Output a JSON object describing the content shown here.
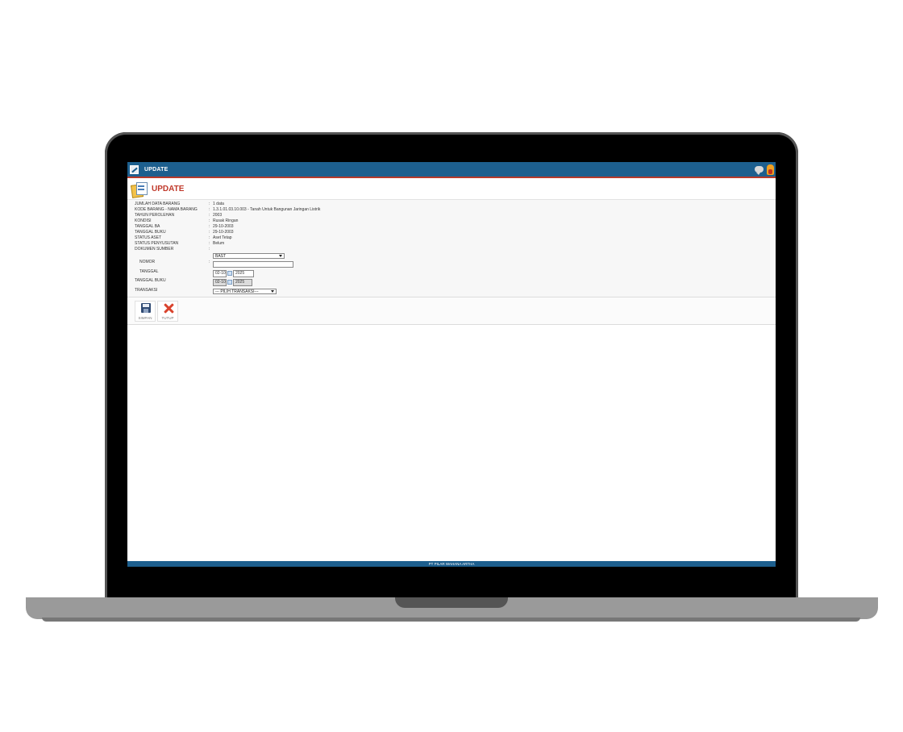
{
  "window": {
    "title": "UPDATE"
  },
  "page": {
    "title": "UPDATE"
  },
  "form": {
    "fields": [
      {
        "label": "JUMLAH DATA BARANG",
        "value": "1 data"
      },
      {
        "label": "KODE BARANG - NAMA BARANG",
        "value": "1.3.1.01.03.10.003 - Tanah Untuk Bangunan Jaringan Listrik"
      },
      {
        "label": "TAHUN PEROLEHAN",
        "value": "2003"
      },
      {
        "label": "KONDISI",
        "value": "Rusak Ringan"
      },
      {
        "label": "TANGGAL BA",
        "value": "29-10-2003"
      },
      {
        "label": "TANGGAL BUKU",
        "value": "29-10-2003"
      },
      {
        "label": "STATUS ASET",
        "value": "Aset Tetap"
      },
      {
        "label": "STATUS PENYUSUTAN",
        "value": "Belum"
      }
    ],
    "dokumen_sumber": {
      "label": "DOKUMEN SUMBER",
      "value": "BAST"
    },
    "nomor": {
      "label": "NOMOR",
      "value": ""
    },
    "tanggal": {
      "label": "TANGGAL",
      "daymonth": "02-10",
      "year": "2025"
    },
    "tanggal_buku": {
      "label": "TANGGAL BUKU",
      "daymonth": "02-10",
      "year": "2025"
    },
    "transaksi": {
      "label": "TRANSAKSI",
      "value": "--- PILIH TRANSAKSI---"
    },
    "separator": ":"
  },
  "toolbar": {
    "save_label": "SIMPAN",
    "close_label": "TUTUP"
  },
  "footer": {
    "text": "PT PILAR WAHANA ARTHA"
  },
  "colors": {
    "header_blue": "#1d5f8e",
    "accent_red": "#c0392b"
  }
}
